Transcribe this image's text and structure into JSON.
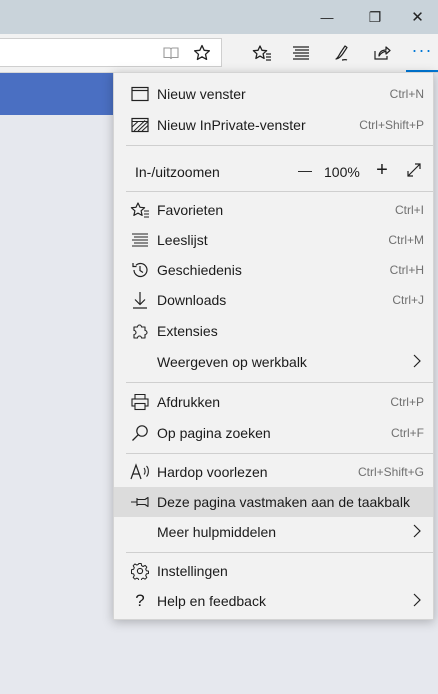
{
  "window": {
    "minimize_glyph": "—",
    "maximize_glyph": "❐",
    "close_glyph": "✕"
  },
  "toolbar": {
    "icons": [
      "reading-view-icon",
      "favorite-star-icon",
      "favorites-icon",
      "reading-list-icon",
      "notes-pen-icon",
      "share-icon",
      "more-dots-icon"
    ]
  },
  "menu": {
    "new_window": {
      "label": "Nieuw venster",
      "shortcut": "Ctrl+N"
    },
    "new_inprivate": {
      "label": "Nieuw InPrivate-venster",
      "shortcut": "Ctrl+Shift+P"
    },
    "zoom": {
      "label": "In-/uitzoomen",
      "value": "100%",
      "minus": "—",
      "plus": "+"
    },
    "favorites": {
      "label": "Favorieten",
      "shortcut": "Ctrl+I"
    },
    "reading_list": {
      "label": "Leeslijst",
      "shortcut": "Ctrl+M"
    },
    "history": {
      "label": "Geschiedenis",
      "shortcut": "Ctrl+H"
    },
    "downloads": {
      "label": "Downloads",
      "shortcut": "Ctrl+J"
    },
    "extensions": {
      "label": "Extensies"
    },
    "show_in_toolbar": {
      "label": "Weergeven op werkbalk"
    },
    "print": {
      "label": "Afdrukken",
      "shortcut": "Ctrl+P"
    },
    "find_on_page": {
      "label": "Op pagina zoeken",
      "shortcut": "Ctrl+F"
    },
    "read_aloud": {
      "label": "Hardop voorlezen",
      "shortcut": "Ctrl+Shift+G"
    },
    "pin_to_taskbar": {
      "label": "Deze pagina vastmaken aan de taakbalk"
    },
    "more_tools": {
      "label": "Meer hulpmiddelen"
    },
    "settings": {
      "label": "Instellingen"
    },
    "help": {
      "label": "Help en feedback"
    }
  },
  "colors": {
    "accent_blue": "#4a6fc2",
    "menu_bg": "#f2f2f2",
    "highlight": "#dcdcdc",
    "titlebar": "#c9d3da",
    "more_button_underline": "#0078d7"
  }
}
